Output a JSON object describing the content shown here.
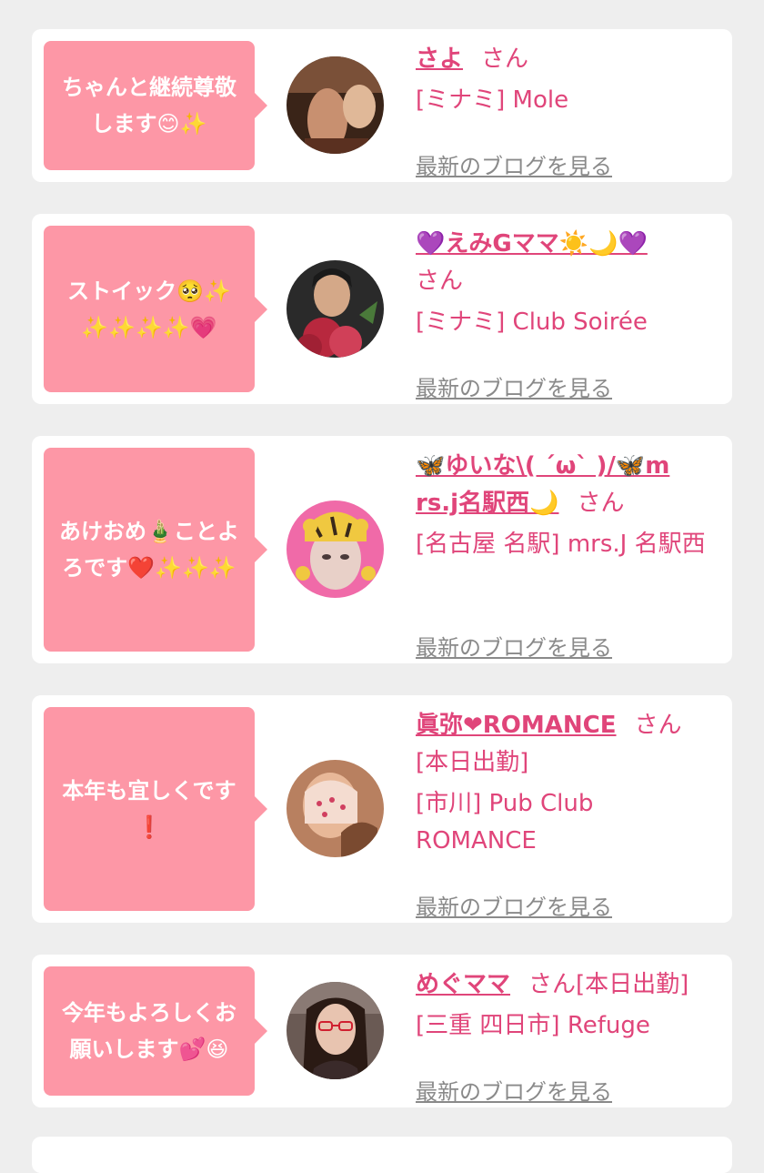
{
  "posts": [
    {
      "message": "ちゃんと継続尊敬します😊✨",
      "name": "さよ",
      "honorific": "さん",
      "shop": "[ミナミ] Mole",
      "blog_link": "最新のブログを見る",
      "avatar_colors": [
        "#4a2c1c",
        "#a87050",
        "#e8c0a0"
      ]
    },
    {
      "message": "ストイック🥺✨✨✨✨✨💗",
      "name": "💜えみGママ☀️🌙💜",
      "honorific": "さん",
      "shop": "[ミナミ] Club Soirée",
      "blog_link": "最新のブログを見る",
      "avatar_colors": [
        "#2a2a2a",
        "#d4a888",
        "#c0304a"
      ]
    },
    {
      "message": "あけおめ🎍ことよろです❤️✨✨✨",
      "name": "🦋ゆいな\\( ´ω` )/🦋mrs.j名駅西🌙",
      "honorific": "さん",
      "shop": "[名古屋 名駅] mrs.J 名駅西",
      "blog_link": "最新のブログを見る",
      "avatar_colors": [
        "#f06aa8",
        "#f0c840",
        "#e8d0c8"
      ]
    },
    {
      "message": "本年も宜しくです❗️",
      "name": "眞弥❤ROMANCE",
      "honorific": "さん",
      "status": "[本日出勤]",
      "shop": "[市川] Pub Club ROMANCE",
      "blog_link": "最新のブログを見る",
      "avatar_colors": [
        "#c8906a",
        "#f4dcd0",
        "#7a4a30"
      ]
    },
    {
      "message": "今年もよろしくお願いします💕😆",
      "name": "めぐママ",
      "honorific": "さん",
      "status": "[本日出勤]",
      "shop": "[三重 四日市] Refuge",
      "blog_link": "最新のブログを見る",
      "avatar_colors": [
        "#5a4a44",
        "#e8c4b0",
        "#2a1a14"
      ]
    }
  ]
}
